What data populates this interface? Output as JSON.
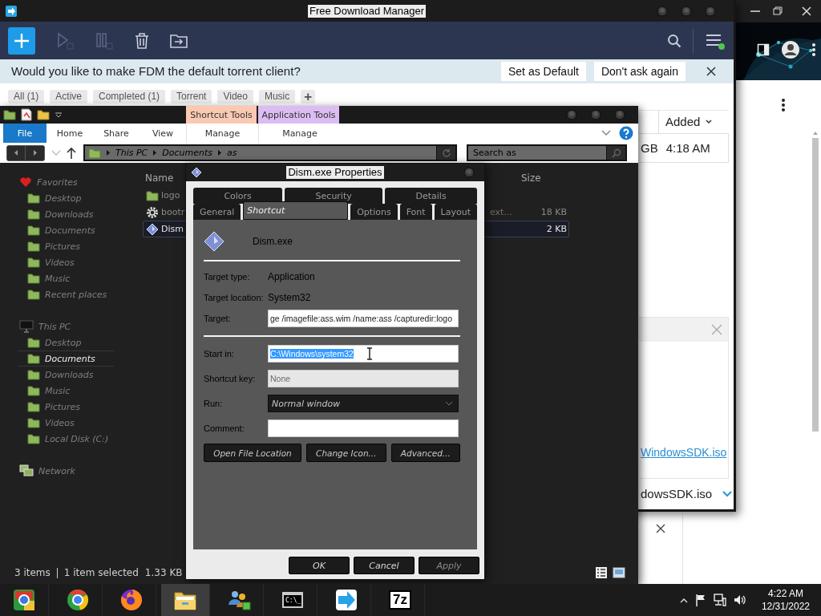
{
  "fdm": {
    "title": "Free Download Manager",
    "menu_badge": true,
    "banner": {
      "text": "Would you like to make FDM the default torrent client?",
      "buttons": [
        "Set as Default",
        "Don't ask again"
      ]
    },
    "filters": [
      "All (1)",
      "Active",
      "Completed (1)",
      "Torrent",
      "Video",
      "Music"
    ],
    "add_filter": "+",
    "list": {
      "column": "Added",
      "size": "GB",
      "added": "4:18 AM"
    },
    "details": {
      "link": "WindowsSDK.iso"
    },
    "bottom": {
      "file": "dowsSDK.iso"
    }
  },
  "explorer": {
    "context_tabs": [
      {
        "label": "Shortcut Tools",
        "color": "#f9c9b1"
      },
      {
        "label": "Application Tools",
        "color": "#dcbdf3"
      }
    ],
    "ribbon_tabs": [
      {
        "label": "File",
        "kind": "file"
      },
      {
        "label": "Home",
        "kind": "tab"
      },
      {
        "label": "Share",
        "kind": "tab"
      },
      {
        "label": "View",
        "kind": "tab"
      },
      {
        "label": "Manage",
        "kind": "context"
      },
      {
        "label": "Manage",
        "kind": "context"
      }
    ],
    "breadcrumb": [
      "This PC",
      "Documents",
      "as"
    ],
    "search": {
      "placeholder": "Search as"
    },
    "nav": [
      {
        "label": "Favorites",
        "kind": "favorites",
        "children": [
          {
            "label": "Desktop",
            "selected": false
          },
          {
            "label": "Downloads",
            "selected": false
          },
          {
            "label": "Documents",
            "selected": false
          },
          {
            "label": "Pictures",
            "selected": false
          },
          {
            "label": "Videos",
            "selected": false
          },
          {
            "label": "Music",
            "selected": false
          },
          {
            "label": "Recent places",
            "selected": false
          }
        ]
      },
      {
        "label": "This PC",
        "kind": "pc",
        "children": [
          {
            "label": "Desktop",
            "selected": false
          },
          {
            "label": "Documents",
            "selected": true
          },
          {
            "label": "Downloads",
            "selected": false
          },
          {
            "label": "Music",
            "selected": false
          },
          {
            "label": "Pictures",
            "selected": false
          },
          {
            "label": "Videos",
            "selected": false
          },
          {
            "label": "Local Disk (C:)",
            "selected": false
          }
        ]
      },
      {
        "label": "Network",
        "kind": "network"
      }
    ],
    "columns": {
      "name": "Name",
      "size": "Size"
    },
    "files": [
      {
        "name": "logo",
        "kind": "folder",
        "selected": false
      },
      {
        "name": "bootr",
        "kind": "settings",
        "type": "ext...",
        "size": "18 KB",
        "selected": false
      },
      {
        "name": "Dism",
        "kind": "shortcut",
        "size": "2 KB",
        "selected": true
      }
    ],
    "status": {
      "count": "3 items",
      "selection": "1 item selected",
      "size": "1.33 KB"
    }
  },
  "dialog": {
    "title": "Dism.exe Properties",
    "tabs": [
      [
        {
          "label": "Colors",
          "selected": false
        },
        {
          "label": "Security",
          "selected": false
        },
        {
          "label": "Details",
          "selected": false
        }
      ],
      [
        {
          "label": "General",
          "selected": false
        },
        {
          "label": "Shortcut",
          "selected": true
        },
        {
          "label": "Options",
          "selected": false
        },
        {
          "label": "Font",
          "selected": false
        },
        {
          "label": "Layout",
          "selected": false
        }
      ]
    ],
    "app_name": "Dism.exe",
    "field_groups": [
      [
        {
          "label": "Target type:",
          "kind": "text",
          "value": "Application"
        },
        {
          "label": "Target location:",
          "kind": "text",
          "value": "System32"
        },
        {
          "label": "Target:",
          "kind": "input",
          "value": "ge /imagefile:ass.wim /name:ass /capturedir:logo",
          "disabled": false,
          "text_selected": false,
          "cursor": false
        }
      ],
      [
        {
          "label": "Start in:",
          "kind": "input",
          "value": "C:\\Windows\\system32",
          "disabled": false,
          "text_selected": true,
          "cursor": true
        },
        {
          "label": "Shortcut key:",
          "kind": "input",
          "value": "None",
          "disabled": true,
          "text_selected": false,
          "cursor": false
        },
        {
          "label": "Run:",
          "kind": "select",
          "value": "Normal window"
        },
        {
          "label": "Comment:",
          "kind": "input",
          "disabled": false,
          "text_selected": false,
          "cursor": false
        }
      ]
    ],
    "actions": [
      "Open File Location",
      "Change Icon...",
      "Advanced..."
    ],
    "buttons": [
      {
        "label": "OK",
        "disabled": false
      },
      {
        "label": "Cancel",
        "disabled": false
      },
      {
        "label": "Apply",
        "disabled": true
      }
    ]
  },
  "taskbar": {
    "apps": [
      {
        "kind": "chromium",
        "selected": false
      },
      {
        "kind": "chrome",
        "selected": false
      },
      {
        "kind": "firefox",
        "selected": false
      },
      {
        "kind": "explorer",
        "selected": true
      },
      {
        "kind": "people",
        "selected": false
      },
      {
        "kind": "terminal",
        "label": "C:\\_",
        "selected": false
      },
      {
        "kind": "fdm",
        "selected": false
      },
      {
        "kind": "archiver",
        "label": "7z",
        "selected": false
      }
    ],
    "time": "4:22 AM",
    "date": "12/31/2022"
  }
}
